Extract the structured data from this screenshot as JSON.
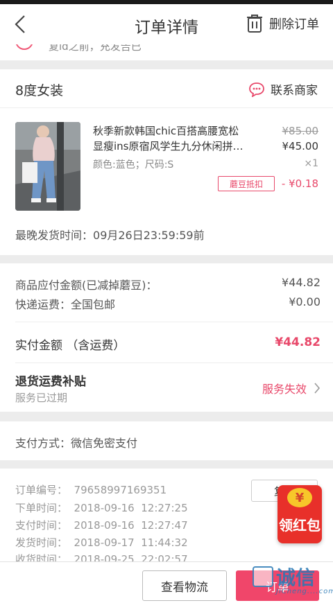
{
  "header": {
    "title": "订单详情",
    "delete_label": "删除订单"
  },
  "clipped_text": "复ld之前，充发告已",
  "shop": {
    "name": "8度女装",
    "contact_label": "联系商家"
  },
  "product": {
    "title_line1": "秋季新款韩国chic百搭高腰宽松",
    "title_line2": "显瘦ins原宿风学生九分休闲拼…",
    "spec": "颜色:蓝色；尺码:S",
    "original_price": "¥85.00",
    "price": "¥45.00",
    "quantity": "×1",
    "badge": "蘑豆抵扣",
    "deduction": "- ¥0.18",
    "ship_time_label": "最晚发货时间：",
    "ship_time_value": "09月26日23:59:59前"
  },
  "amounts": {
    "goods_label": "商品应付金额(已减掉蘑豆)：",
    "goods_value": "¥44.82",
    "shipping_label": "快递运费：全国包邮",
    "shipping_value": "¥0.00",
    "paid_label": "实付金额 （含运费）",
    "paid_value": "¥44.82",
    "refund_title": "退货运费补贴",
    "refund_sub": "服务已过期",
    "refund_status": "服务失效"
  },
  "payment": {
    "text": "支付方式：微信免密支付"
  },
  "info": {
    "order_no": "订单编号：  79658997169351",
    "order_time": "下单时间：  2018-09-16  12:27:25",
    "pay_time": "支付时间：  2018-09-16  12:27:47",
    "ship_time": "发货时间：  2018-09-17  11:44:32",
    "receive_time": "收货时间：  2018-09-25  22:02:57",
    "copy_label": "复制"
  },
  "redpack": {
    "coin": "¥",
    "label": "领红包"
  },
  "footer": {
    "logistics_label": "查看物流",
    "confirm_label": "订单"
  },
  "watermark": {
    "main": "诚信",
    "sub": "JiCheng....com"
  },
  "colors": {
    "accent": "#e8486a",
    "button_pink": "#f0466a",
    "redpack": "#e8302a"
  }
}
